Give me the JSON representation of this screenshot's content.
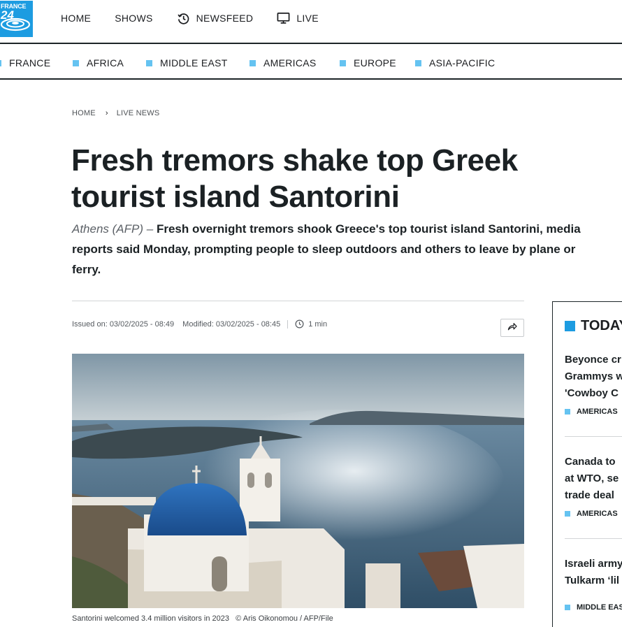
{
  "logo": {
    "line1": "FRANCE",
    "line2": "24"
  },
  "main_nav": [
    {
      "label": "HOME",
      "icon": ""
    },
    {
      "label": "SHOWS",
      "icon": ""
    },
    {
      "label": "NEWSFEED",
      "icon": "history-icon"
    },
    {
      "label": "LIVE",
      "icon": "tv-icon"
    }
  ],
  "regions": [
    "FRANCE",
    "AFRICA",
    "MIDDLE EAST",
    "AMERICAS",
    "EUROPE",
    "ASIA-PACIFIC"
  ],
  "breadcrumb": {
    "home": "HOME",
    "section": "LIVE NEWS"
  },
  "article": {
    "title": "Fresh tremors shake top Greek tourist island Santorini",
    "dateline": "Athens (AFP) –",
    "lead": "Fresh overnight tremors shook Greece's top tourist island Santorini, media reports said Monday, prompting people to sleep outdoors and others to leave by plane or ferry.",
    "issued": "Issued on: 03/02/2025 - 08:49",
    "modified": "Modified: 03/02/2025 - 08:45",
    "read_time": "1 min",
    "caption": "Santorini welcomed 3.4 million visitors in 2023",
    "credit": "© Aris Oikonomou / AFP/File"
  },
  "sidebar": {
    "heading": "TODAY",
    "items": [
      {
        "headline_lines": [
          "Beyonce cr",
          "Grammys w",
          "'Cowboy C"
        ],
        "tag": "AMERICAS"
      },
      {
        "headline_lines": [
          "Canada to",
          "at WTO, se",
          "trade deal"
        ],
        "tag": "AMERICAS"
      },
      {
        "headline_lines": [
          "Israeli army",
          "Tulkarm ‘lil"
        ],
        "tag": "MIDDLE EAS"
      }
    ]
  },
  "colors": {
    "brand_blue": "#1d9ce1",
    "region_marker": "#65c3f1",
    "text_dark": "#1b2124"
  }
}
